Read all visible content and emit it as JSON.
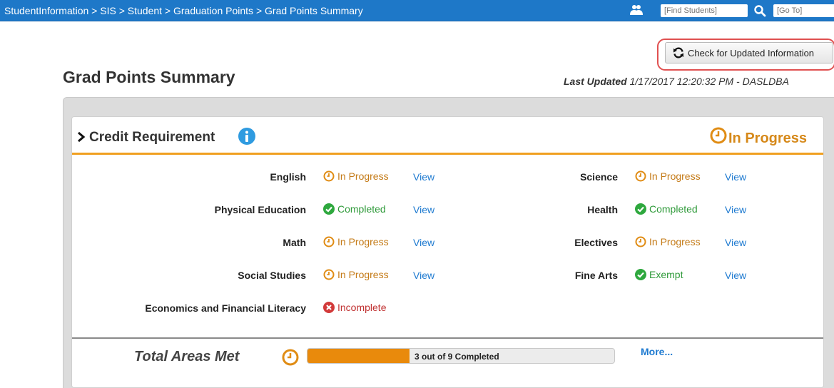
{
  "nav": {
    "breadcrumb": "StudentInformation > SIS > Student > Graduation Points > Grad Points Summary",
    "find_placeholder": "[Find Students]",
    "goto_placeholder": "[Go To]"
  },
  "toolbar": {
    "refresh_label": "Check for Updated Information"
  },
  "page": {
    "title": "Grad Points Summary",
    "last_updated_label": "Last Updated",
    "last_updated_value": "1/17/2017 12:20:32 PM - DASLDBA"
  },
  "credit": {
    "title": "Credit Requirement",
    "overall_status": "In Progress",
    "view_label": "View",
    "requirements": [
      {
        "label": "English",
        "status": "In Progress",
        "state": "progress",
        "has_view": true
      },
      {
        "label": "Science",
        "status": "In Progress",
        "state": "progress",
        "has_view": true
      },
      {
        "label": "Physical Education",
        "status": "Completed",
        "state": "complete",
        "has_view": true
      },
      {
        "label": "Health",
        "status": "Completed",
        "state": "complete",
        "has_view": true
      },
      {
        "label": "Math",
        "status": "In Progress",
        "state": "progress",
        "has_view": true
      },
      {
        "label": "Electives",
        "status": "In Progress",
        "state": "progress",
        "has_view": true
      },
      {
        "label": "Social Studies",
        "status": "In Progress",
        "state": "progress",
        "has_view": true
      },
      {
        "label": "Fine Arts",
        "status": "Exempt",
        "state": "complete",
        "has_view": true
      },
      {
        "label": "Economics and Financial Literacy",
        "status": "Incomplete",
        "state": "incomplete",
        "has_view": false
      }
    ]
  },
  "total": {
    "label": "Total Areas Met",
    "progress_text": "3 out of 9 Completed",
    "completed": 3,
    "required": 9,
    "more_label": "More..."
  },
  "colors": {
    "nav": "#1e78c8",
    "in_progress": "#d6891a",
    "completed": "#2f9a3a",
    "incomplete": "#c03030",
    "link": "#1e7ad0",
    "progress_fill": "#e98a0c"
  }
}
